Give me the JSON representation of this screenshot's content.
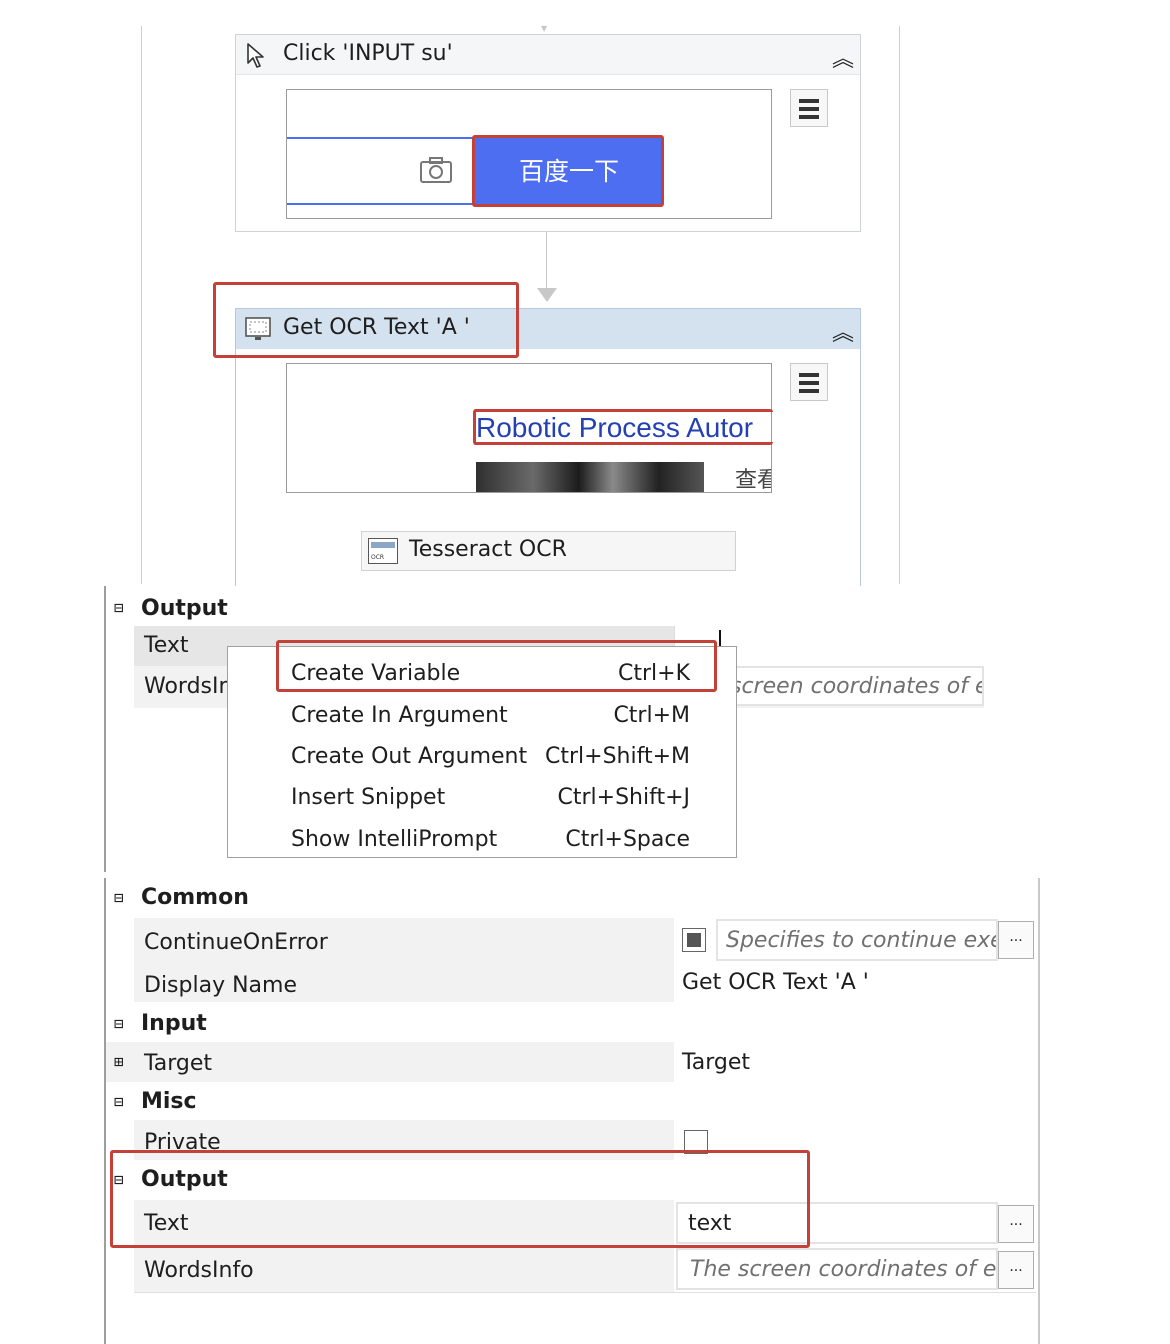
{
  "designer": {
    "click_activity": {
      "title": "Click 'INPUT  su'",
      "button_label": "百度一下"
    },
    "ocr_activity": {
      "title": "Get OCR Text 'A '",
      "preview_link": "Robotic Process Autor",
      "preview_side_text": "查看",
      "engine_label": "Tesseract OCR",
      "engine_badge": "OCR"
    }
  },
  "property_panel_top": {
    "category": "Output",
    "rows": [
      {
        "name": "Text",
        "value": ""
      },
      {
        "name": "WordsIn",
        "value": "screen coordinates of e"
      }
    ]
  },
  "context_menu": {
    "items": [
      {
        "label": "Create Variable",
        "shortcut": "Ctrl+K"
      },
      {
        "label": "Create In Argument",
        "shortcut": "Ctrl+M"
      },
      {
        "label": "Create Out Argument",
        "shortcut": "Ctrl+Shift+M"
      },
      {
        "label": "Insert Snippet",
        "shortcut": "Ctrl+Shift+J"
      },
      {
        "label": "Show IntelliPrompt",
        "shortcut": "Ctrl+Space"
      }
    ]
  },
  "property_panel_bottom": {
    "common": {
      "label": "Common",
      "continue_on_error": {
        "name": "ContinueOnError",
        "hint": "Specifies to continue exe"
      },
      "display_name": {
        "name": "Display Name",
        "value": "Get OCR Text 'A '"
      }
    },
    "input": {
      "label": "Input",
      "target": {
        "name": "Target",
        "value": "Target"
      }
    },
    "misc": {
      "label": "Misc",
      "private": {
        "name": "Private"
      }
    },
    "output": {
      "label": "Output",
      "text": {
        "name": "Text",
        "value": "text"
      },
      "words_info": {
        "name": "WordsInfo",
        "hint": "The screen coordinates of e"
      }
    },
    "ellipsis": "...",
    "collapse_glyph": "⊟",
    "expand_glyph": "⊞"
  },
  "colors": {
    "highlight_red": "#c4413a",
    "button_blue": "#4e6ef2",
    "activity_header_blue": "#d4e1ef",
    "link_blue": "#2440b3"
  }
}
